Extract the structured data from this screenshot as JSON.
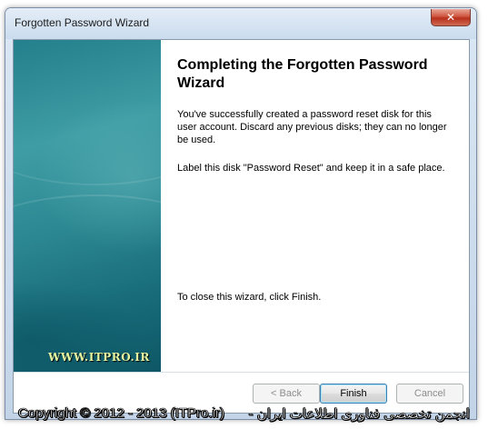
{
  "window": {
    "title": "Forgotten Password Wizard",
    "close_glyph": "✕"
  },
  "side_panel": {
    "watermark": "WWW.ITPRO.IR"
  },
  "content": {
    "heading": "Completing the Forgotten Password Wizard",
    "paragraph1": "You've successfully created a password reset disk for this user account. Discard any previous disks; they can no longer be used.",
    "paragraph2": "Label this disk \"Password Reset\" and keep it in a safe place.",
    "closing": "To close this wizard, click Finish."
  },
  "buttons": {
    "back": "< Back",
    "finish": "Finish",
    "cancel": "Cancel"
  },
  "footer_watermark": {
    "left": "Copyright © 2012 - 2013 (ITPro.ir)",
    "right": "انجمن تخصصی فناوری اطلاعات ایران -"
  },
  "colors": {
    "side_panel": "#2b8791",
    "close_button": "#c9432d",
    "default_button_border": "#3c7fb1"
  }
}
